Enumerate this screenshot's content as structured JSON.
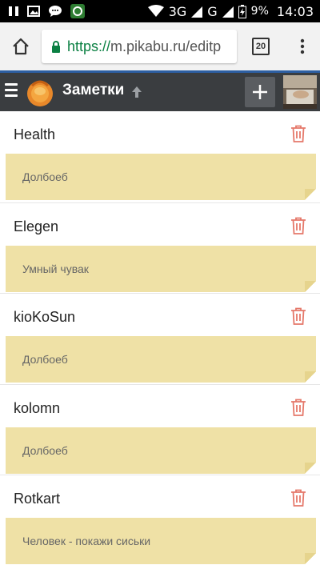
{
  "status_bar": {
    "network_1": "3G",
    "network_2": "G",
    "battery": "9%",
    "time": "14:03"
  },
  "browser": {
    "url_scheme": "https://",
    "url_rest": "m.pikabu.ru/editp",
    "tab_count": "20",
    "icons": [
      "home-icon",
      "lock-icon",
      "menu-dots-icon"
    ]
  },
  "app": {
    "title": "Заметки",
    "brand_color": "#3a3d40",
    "accent_color": "#2d5fa3"
  },
  "notes": [
    {
      "name": "Health",
      "text": "Долбоеб"
    },
    {
      "name": "Elegen",
      "text": "Умный чувак"
    },
    {
      "name": "kioKoSun",
      "text": "Долбоеб"
    },
    {
      "name": "kolomn",
      "text": "Долбоеб"
    },
    {
      "name": "Rotkart",
      "text": "Человек - покажи сиськи"
    }
  ]
}
